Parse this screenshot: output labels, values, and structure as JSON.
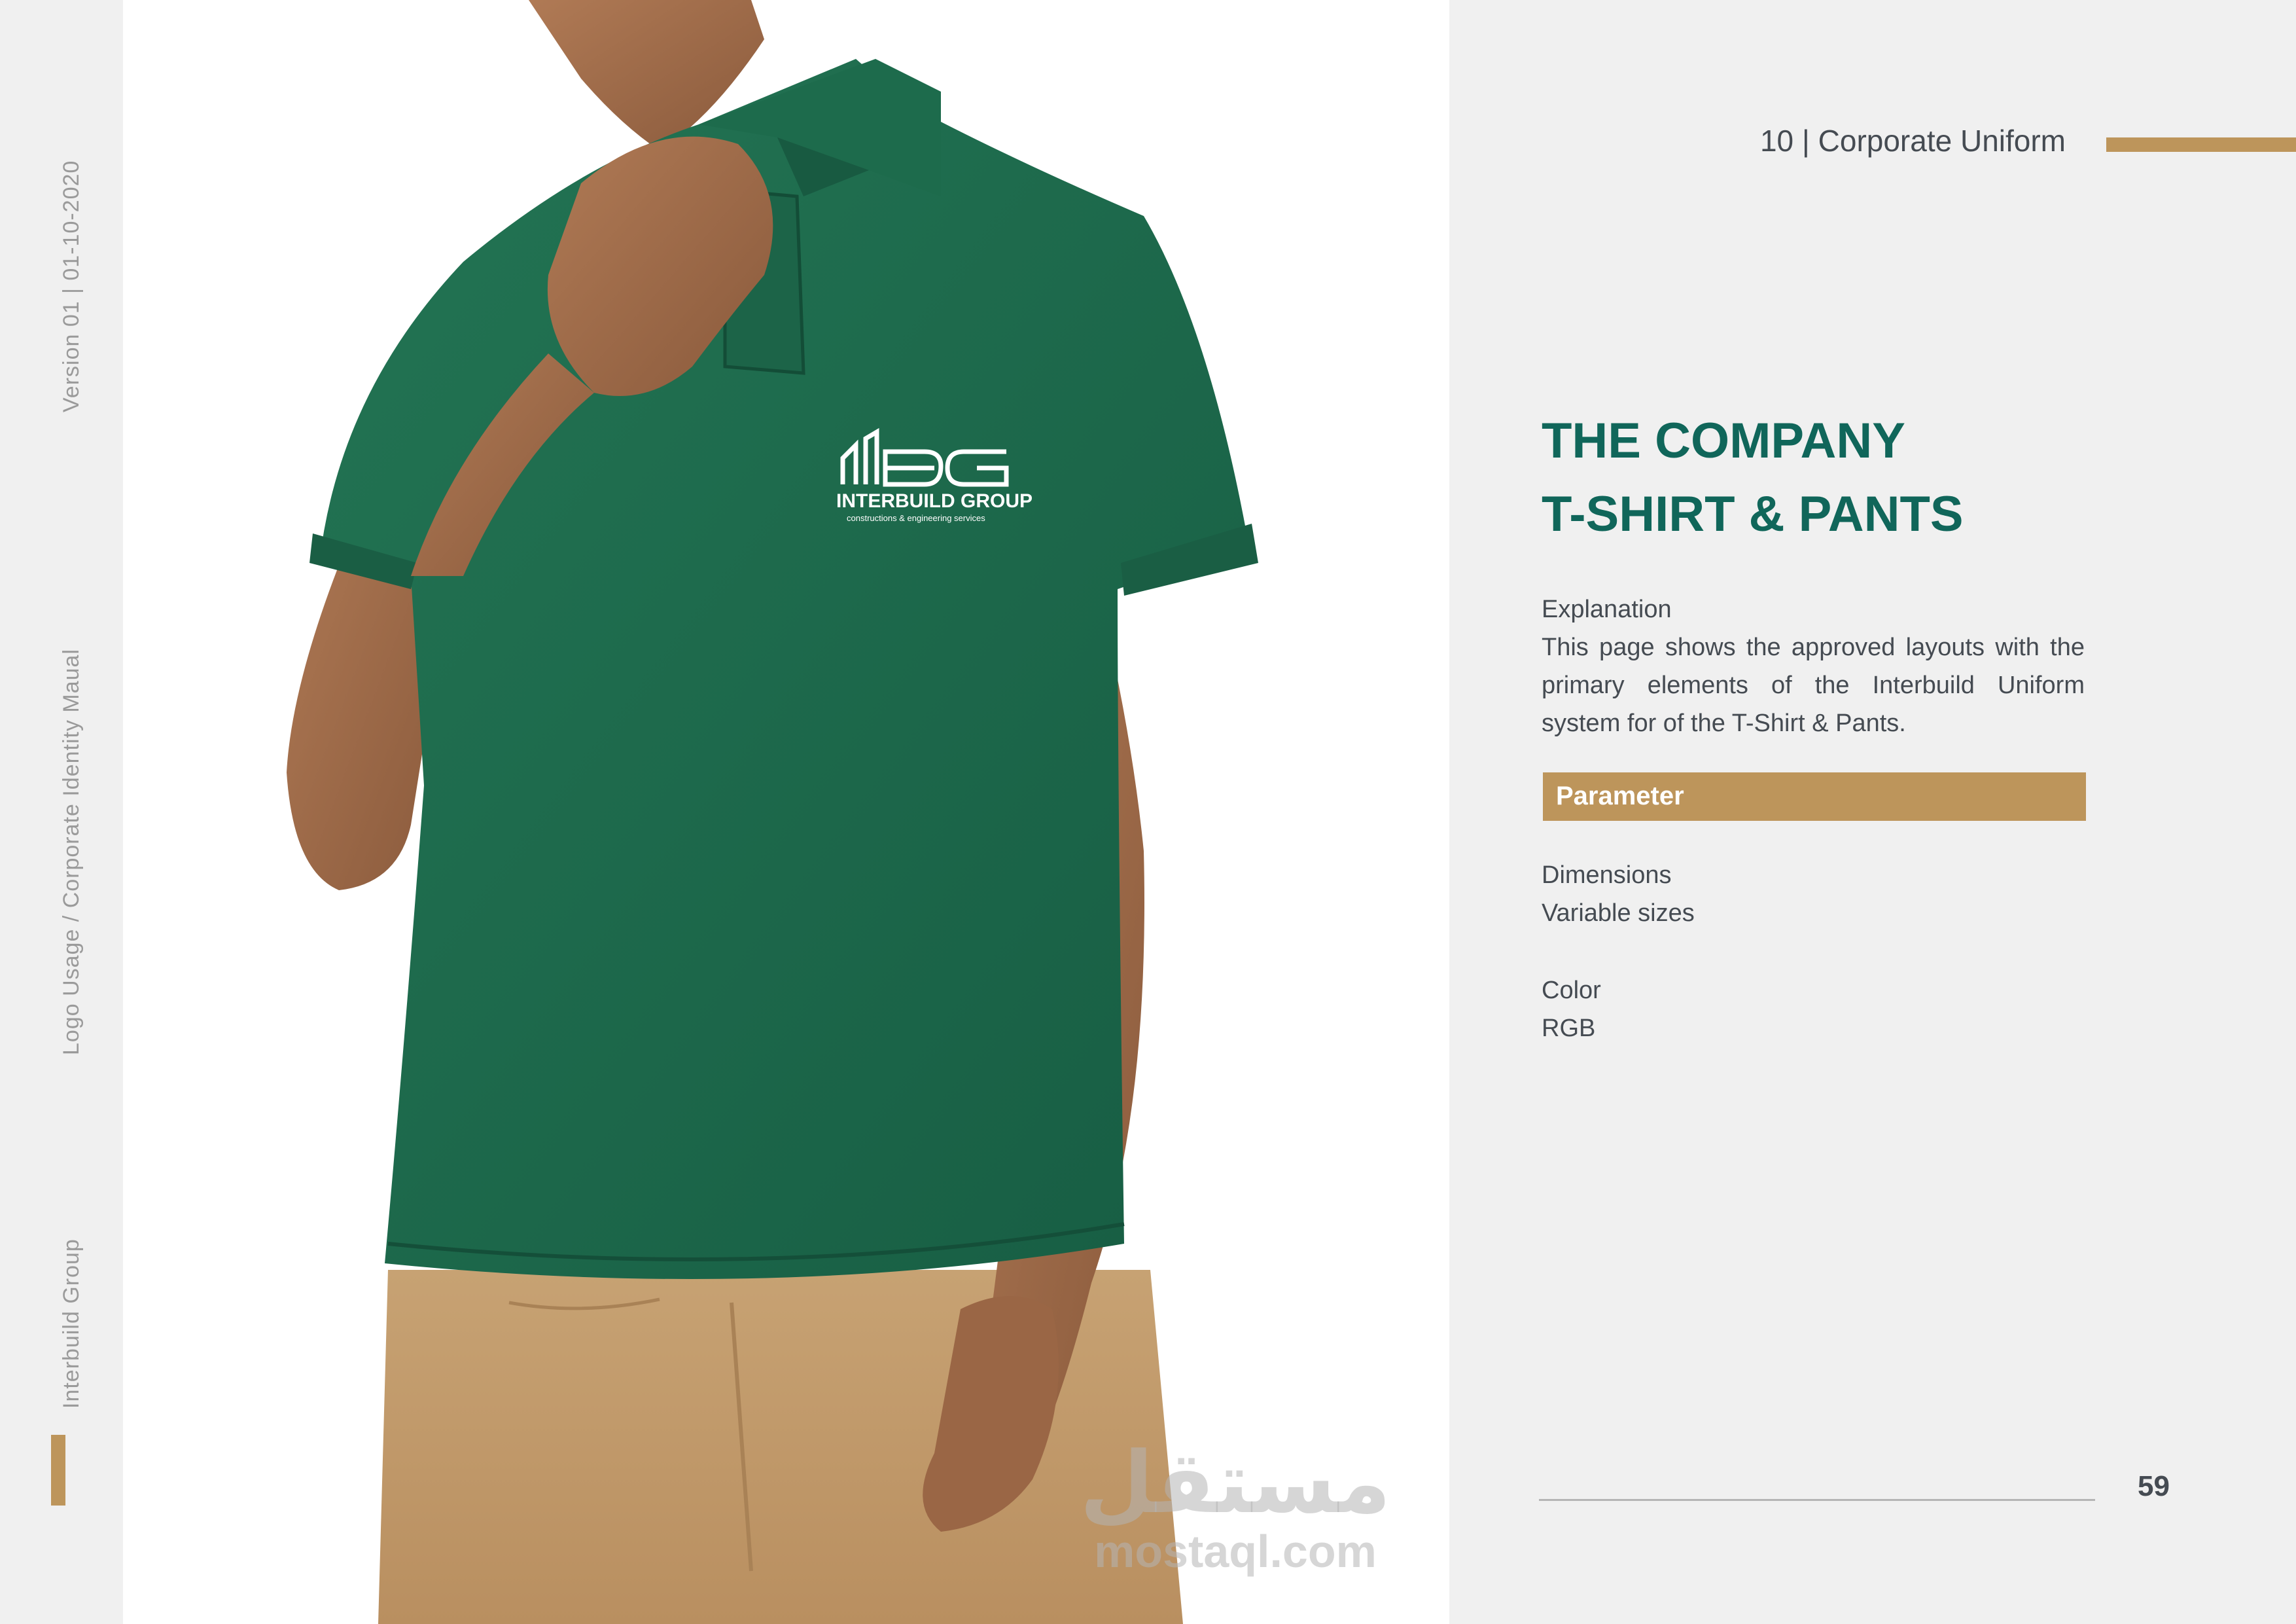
{
  "sidebar": {
    "version": "Version 01 | 01-10-2020",
    "manual": "Logo Usage / Corporate Identity Maual",
    "company": "Interbuild Group"
  },
  "header": {
    "section": "10 | Corporate Uniform"
  },
  "title": {
    "line1": "THE COMPANY",
    "line2": "T-SHIRT & PANTS"
  },
  "explanation": {
    "label": "Explanation",
    "text": "This page shows the approved layouts with the primary elements of the Interbuild Uniform system for of the T-Shirt & Pants."
  },
  "parameter": {
    "label": "Parameter"
  },
  "specs": {
    "dimensions_label": "Dimensions",
    "dimensions_value": "Variable sizes",
    "color_label": "Color",
    "color_value": "RGB"
  },
  "footer": {
    "page_number": "59"
  },
  "logo": {
    "name": "INTERBUILD GROUP",
    "tagline": "constructions & engineering services",
    "mark": "IBG"
  },
  "watermark": {
    "arabic": "مستقل",
    "site": "mostaql.com"
  },
  "colors": {
    "accent_gold": "#bd955b",
    "heading_green": "#10665a",
    "shirt_green": "#1f6b4e",
    "pants_khaki": "#c39c6e",
    "text_gray": "#454b52"
  }
}
